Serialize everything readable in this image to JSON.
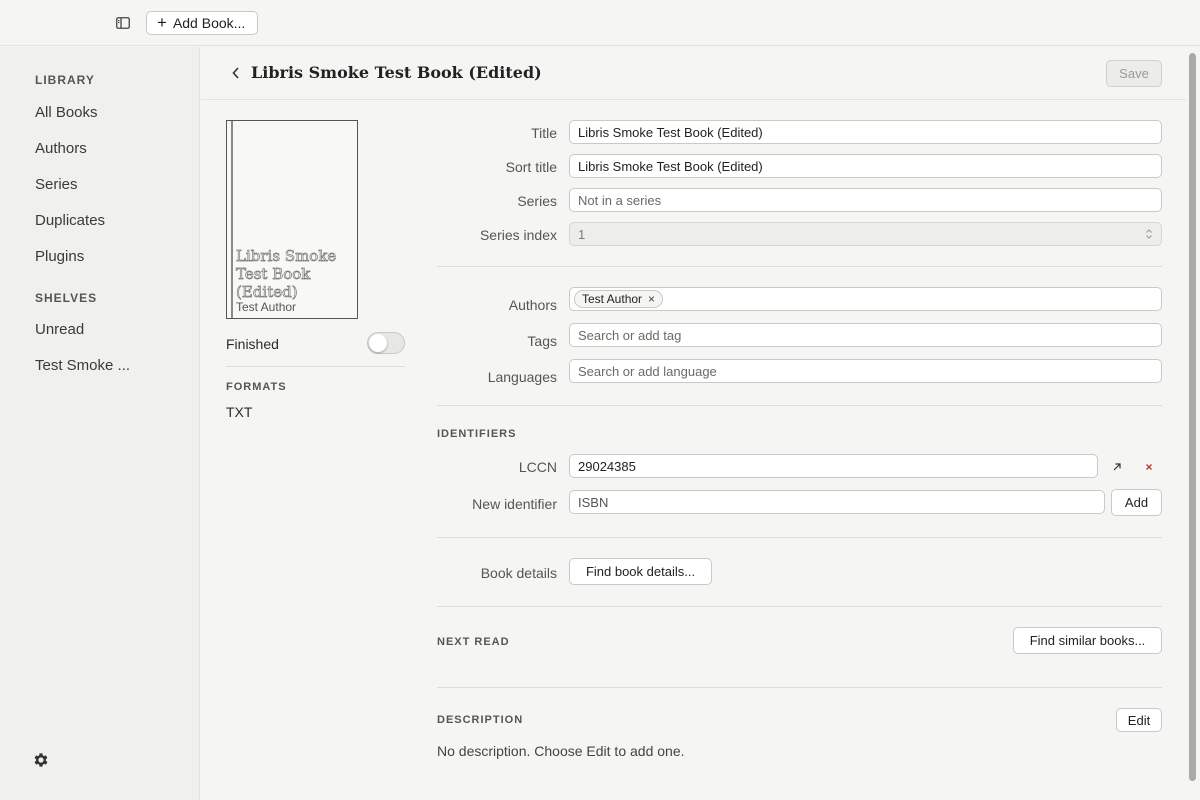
{
  "toolbar": {
    "add_book_label": "Add Book...",
    "sidebar_toggle_icon": "sidebar-icon"
  },
  "sidebar": {
    "library_heading": "LIBRARY",
    "library_items": [
      "All Books",
      "Authors",
      "Series",
      "Duplicates",
      "Plugins"
    ],
    "shelves_heading": "SHELVES",
    "shelf_items": [
      "Unread",
      "Test Smoke ..."
    ],
    "settings_icon": "gear-icon"
  },
  "header": {
    "title": "Libris Smoke Test Book (Edited)",
    "save_label": "Save"
  },
  "cover": {
    "title": "Libris Smoke Test Book (Edited)",
    "author": "Test Author"
  },
  "status": {
    "finished_label": "Finished",
    "finished_on": false
  },
  "formats": {
    "heading": "FORMATS",
    "items": [
      "TXT"
    ]
  },
  "form": {
    "title_label": "Title",
    "title_value": "Libris Smoke Test Book (Edited)",
    "sort_title_label": "Sort title",
    "sort_title_value": "Libris Smoke Test Book (Edited)",
    "series_label": "Series",
    "series_placeholder": "Not in a series",
    "series_index_label": "Series index",
    "series_index_value": "1",
    "authors_label": "Authors",
    "authors": [
      "Test Author"
    ],
    "tags_label": "Tags",
    "tags_placeholder": "Search or add tag",
    "languages_label": "Languages",
    "languages_placeholder": "Search or add language"
  },
  "identifiers": {
    "heading": "IDENTIFIERS",
    "lccn_label": "LCCN",
    "lccn_value": "29024385",
    "new_label": "New identifier",
    "new_type": "ISBN",
    "add_label": "Add"
  },
  "book_details": {
    "label": "Book details",
    "button_label": "Find book details..."
  },
  "next_read": {
    "heading": "NEXT READ",
    "button_label": "Find similar books..."
  },
  "description": {
    "heading": "DESCRIPTION",
    "edit_label": "Edit",
    "text": "No description. Choose Edit to add one."
  },
  "colors": {
    "background": "#f5f5f3",
    "sidebar": "#f0f0ee",
    "remove_red": "#c0392b"
  }
}
